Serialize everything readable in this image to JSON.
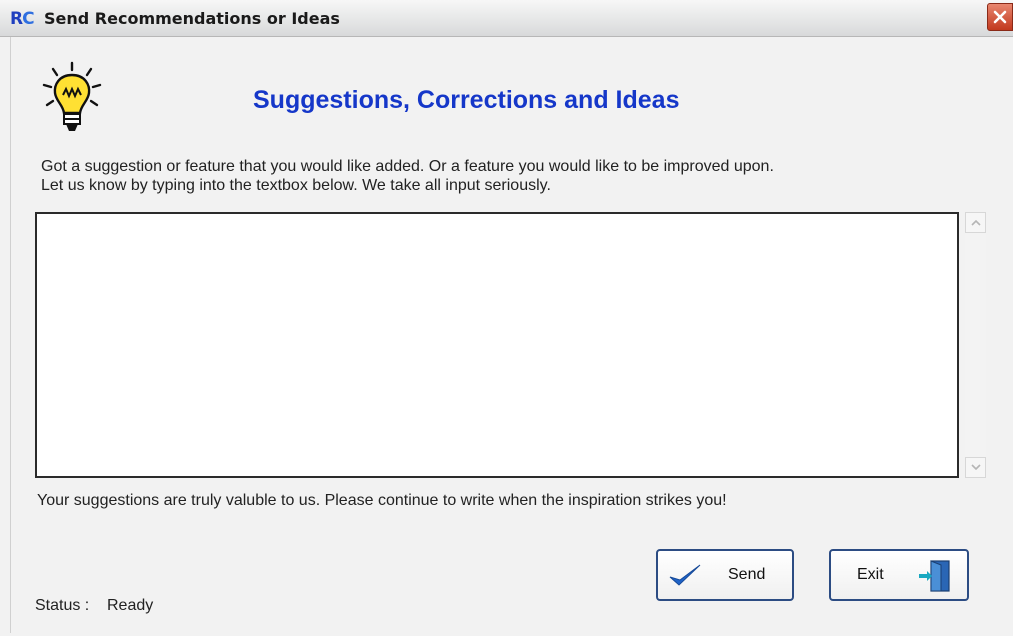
{
  "window": {
    "logo_r": "R",
    "logo_c": "C",
    "title": "Send Recommendations or Ideas"
  },
  "icons": {
    "bulb": "lightbulb-icon",
    "close": "close-icon",
    "send": "checkmark-icon",
    "exit": "exit-door-icon"
  },
  "header": {
    "title": "Suggestions, Corrections and Ideas"
  },
  "intro": {
    "line1": "Got a suggestion or feature that you would like added. Or a feature you would like to be improved upon.",
    "line2": "Let us know by typing into the textbox below. We take all input seriously."
  },
  "textbox": {
    "value": ""
  },
  "footer": {
    "note": "Your suggestions are truly valuble to us. Please continue to write when the inspiration strikes you!"
  },
  "buttons": {
    "send_label": "Send",
    "exit_label": "Exit"
  },
  "status": {
    "label": "Status :",
    "value": "Ready"
  },
  "colors": {
    "heading": "#1537c9",
    "close": "#c2391e",
    "button_border": "#2c4c83",
    "check": "#1f63c8"
  }
}
